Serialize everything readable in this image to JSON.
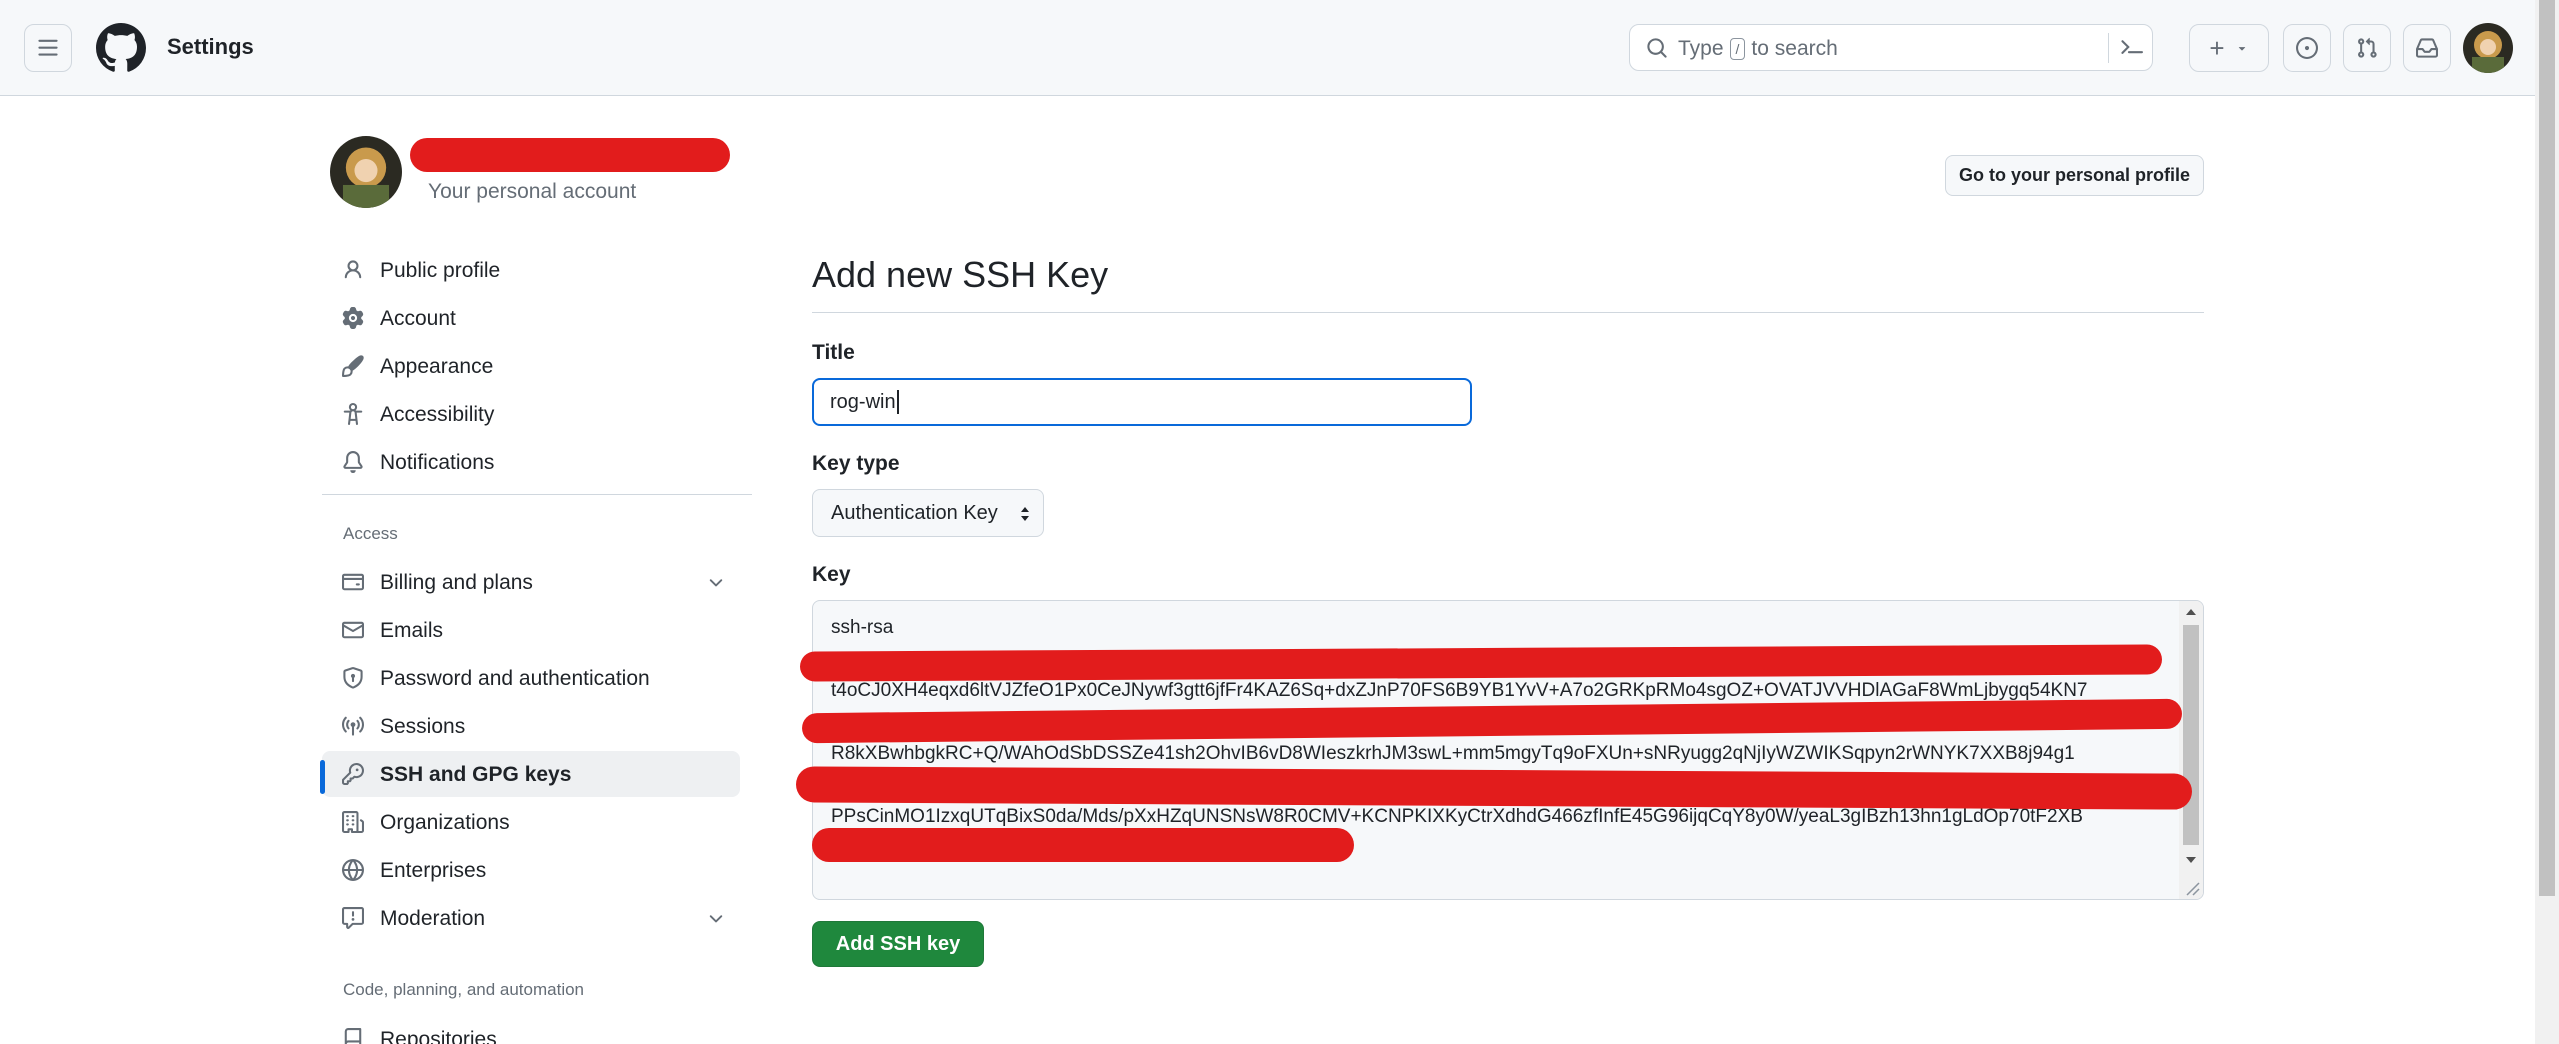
{
  "header": {
    "title": "Settings",
    "search": {
      "placeholder_prefix": "Type",
      "shortcut": "/",
      "placeholder_suffix": "to search"
    },
    "new_button": "+"
  },
  "profile": {
    "subtitle": "Your personal account",
    "go_to_profile": "Go to your personal profile"
  },
  "sidebar": {
    "items": [
      {
        "label": "Public profile",
        "icon": "person-icon"
      },
      {
        "label": "Account",
        "icon": "gear-icon"
      },
      {
        "label": "Appearance",
        "icon": "paintbrush-icon"
      },
      {
        "label": "Accessibility",
        "icon": "accessibility-icon"
      },
      {
        "label": "Notifications",
        "icon": "bell-icon"
      }
    ],
    "access_heading": "Access",
    "access_items": [
      {
        "label": "Billing and plans",
        "icon": "credit-card-icon"
      },
      {
        "label": "Emails",
        "icon": "mail-icon"
      },
      {
        "label": "Password and authentication",
        "icon": "shield-lock-icon"
      },
      {
        "label": "Sessions",
        "icon": "broadcast-icon"
      },
      {
        "label": "SSH and GPG keys",
        "icon": "key-icon"
      },
      {
        "label": "Organizations",
        "icon": "organization-icon"
      },
      {
        "label": "Enterprises",
        "icon": "globe-icon"
      },
      {
        "label": "Moderation",
        "icon": "report-icon"
      }
    ],
    "code_heading": "Code, planning, and automation",
    "code_items": [
      {
        "label": "Repositories",
        "icon": "repo-icon"
      }
    ]
  },
  "main": {
    "heading": "Add new SSH Key",
    "title_label": "Title",
    "title_value": "rog-win",
    "key_type_label": "Key type",
    "key_type_value": "Authentication Key",
    "key_label": "Key",
    "key_lines": [
      "ssh-rsa",
      "t4oCJ0XH4eqxd6ltVJZfeO1Px0CeJNywf3gtt6jfFr4KAZ6Sq+dxZJnP70FS6B9YB1YvV+A7o2GRKpRMo4sgOZ+OVATJVVHDlAGaF8WmLjbygq54KN7",
      "R8kXBwhbgkRC+Q/WAhOdSbDSSZe41sh2OhvIB6vD8WIeszkrhJM3swL+mm5mgyTq9oFXUn+sNRyugg2qNjIyWZWIKSqpyn2rWNYK7XXB8j94g1",
      "PPsCinMO1IzxqUTqBixS0da/Mds/pXxHZqUNSNsW8R0CMV+KCNPKIXKyCtrXdhdG466zfInfE45G96ijqCqY8y0W/yeaL3gIBzh13hn1gLdOp70tF2XB"
    ],
    "submit": "Add SSH key"
  },
  "colors": {
    "accent": "#0969da",
    "primary_button": "#1f883d",
    "redaction": "#e21c1c"
  }
}
